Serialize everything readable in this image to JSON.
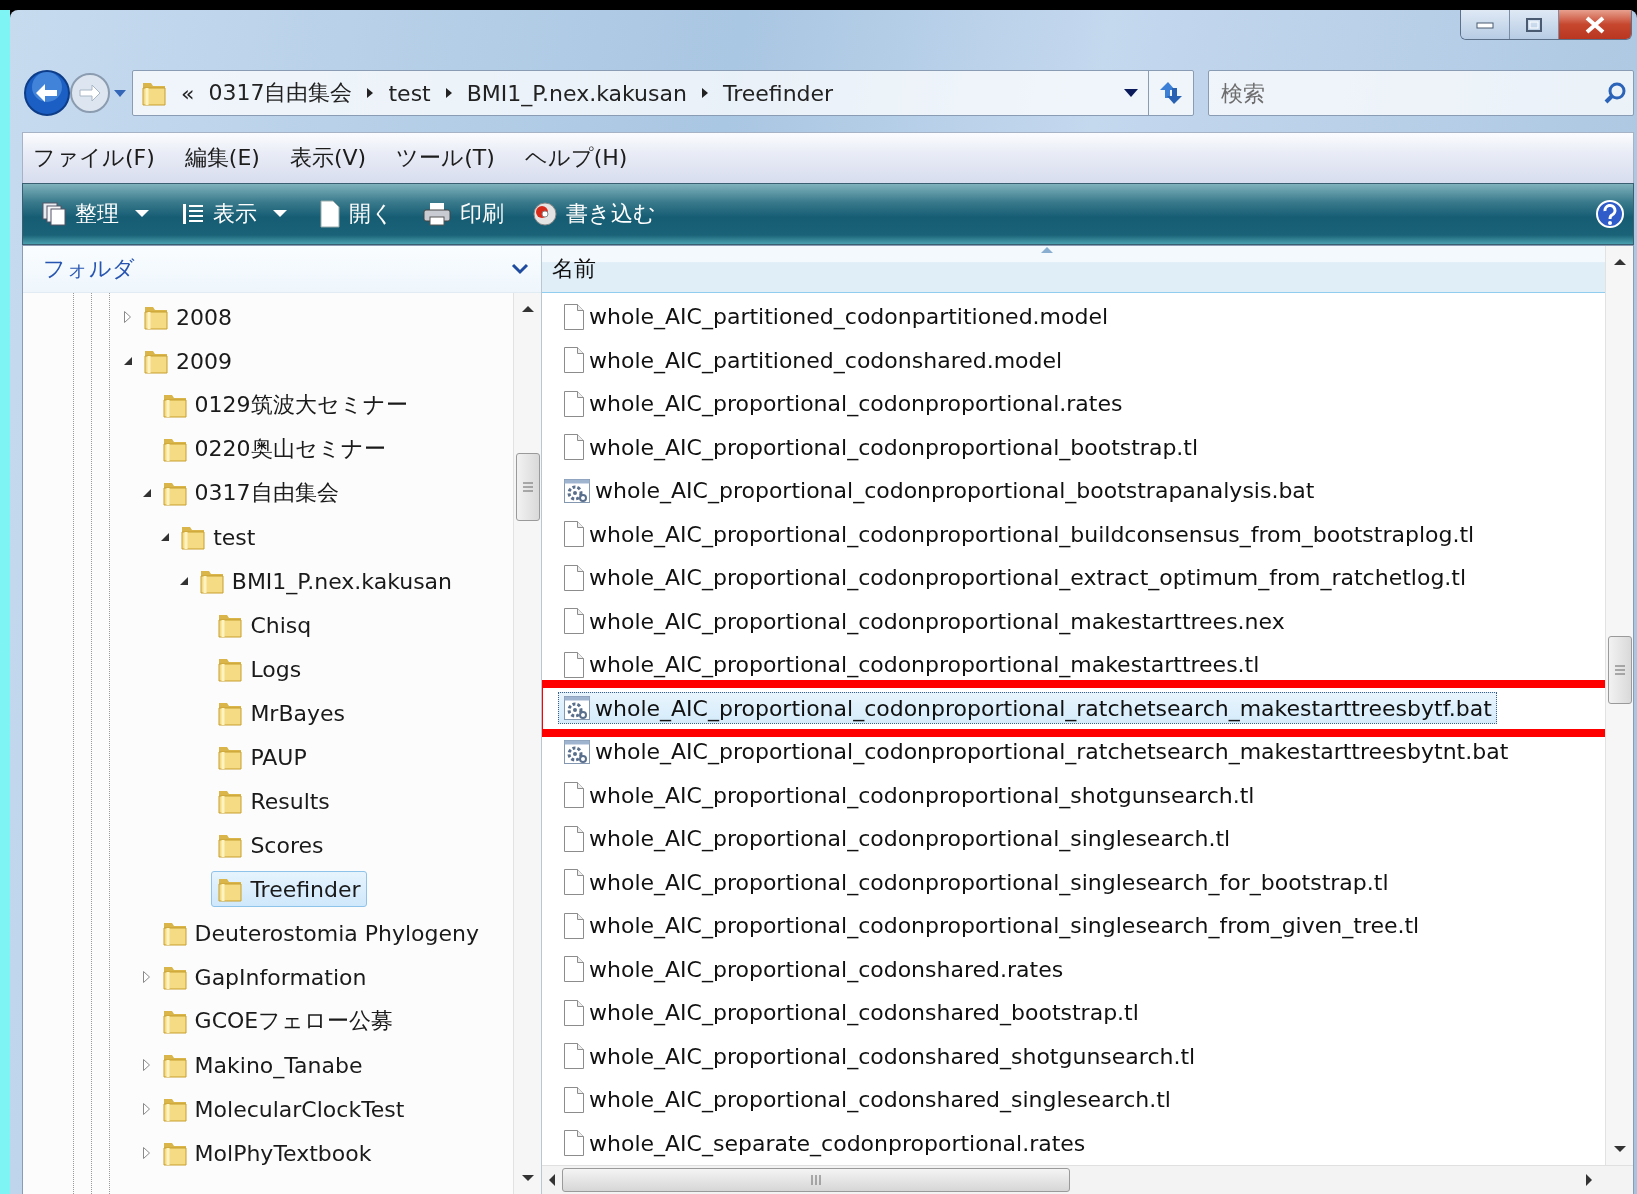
{
  "address_bar": {
    "overflow": "«",
    "crumbs": [
      "0317自由集会",
      "test",
      "BMI1_P.nex.kakusan",
      "Treefinder"
    ]
  },
  "search": {
    "placeholder": "検索"
  },
  "menu_bar": [
    "ファイル(F)",
    "編集(E)",
    "表示(V)",
    "ツール(T)",
    "ヘルプ(H)"
  ],
  "toolbar": [
    {
      "label": "整理",
      "kind": "organize",
      "dropdown": true
    },
    {
      "label": "表示",
      "kind": "views",
      "dropdown": true
    },
    {
      "label": "開く",
      "kind": "open",
      "dropdown": false
    },
    {
      "label": "印刷",
      "kind": "print",
      "dropdown": false
    },
    {
      "label": "書き込む",
      "kind": "burn",
      "dropdown": false
    }
  ],
  "sidebar": {
    "title": "フォルダ",
    "tree": [
      {
        "label": "2008",
        "expanded": false,
        "selected": false
      },
      {
        "label": "2009",
        "expanded": true,
        "selected": false,
        "children": [
          {
            "label": "0129筑波大セミナー",
            "selected": false
          },
          {
            "label": "0220奥山セミナー",
            "selected": false
          },
          {
            "label": "0317自由集会",
            "expanded": true,
            "selected": false,
            "children": [
              {
                "label": "test",
                "expanded": true,
                "selected": false,
                "children": [
                  {
                    "label": "BMI1_P.nex.kakusan",
                    "expanded": true,
                    "selected": false,
                    "children": [
                      {
                        "label": "Chisq",
                        "selected": false
                      },
                      {
                        "label": "Logs",
                        "selected": false
                      },
                      {
                        "label": "MrBayes",
                        "selected": false
                      },
                      {
                        "label": "PAUP",
                        "selected": false
                      },
                      {
                        "label": "Results",
                        "selected": false
                      },
                      {
                        "label": "Scores",
                        "selected": false
                      },
                      {
                        "label": "Treefinder",
                        "selected": true
                      }
                    ]
                  }
                ]
              }
            ]
          },
          {
            "label": "Deuterostomia Phylogeny",
            "selected": false
          },
          {
            "label": "GapInformation",
            "expanded": false,
            "selected": false
          },
          {
            "label": "GCOEフェロー公募",
            "selected": false
          },
          {
            "label": "Makino_Tanabe",
            "expanded": false,
            "selected": false
          },
          {
            "label": "MolecularClockTest",
            "expanded": false,
            "selected": false
          },
          {
            "label": "MolPhyTextbook",
            "expanded": false,
            "selected": false
          }
        ]
      }
    ]
  },
  "file_list": {
    "columns": [
      {
        "label": "名前",
        "sort_ascending": true
      }
    ],
    "rows": [
      {
        "name": "whole_AIC_partitioned_codonpartitioned.model",
        "kind": "document",
        "selected": false,
        "highlighted": false
      },
      {
        "name": "whole_AIC_partitioned_codonshared.model",
        "kind": "document",
        "selected": false,
        "highlighted": false
      },
      {
        "name": "whole_AIC_proportional_codonproportional.rates",
        "kind": "document",
        "selected": false,
        "highlighted": false
      },
      {
        "name": "whole_AIC_proportional_codonproportional_bootstrap.tl",
        "kind": "document",
        "selected": false,
        "highlighted": false
      },
      {
        "name": "whole_AIC_proportional_codonproportional_bootstrapanalysis.bat",
        "kind": "batch",
        "selected": false,
        "highlighted": false
      },
      {
        "name": "whole_AIC_proportional_codonproportional_buildconsensus_from_bootstraplog.tl",
        "kind": "document",
        "selected": false,
        "highlighted": false
      },
      {
        "name": "whole_AIC_proportional_codonproportional_extract_optimum_from_ratchetlog.tl",
        "kind": "document",
        "selected": false,
        "highlighted": false
      },
      {
        "name": "whole_AIC_proportional_codonproportional_makestarttrees.nex",
        "kind": "document",
        "selected": false,
        "highlighted": false
      },
      {
        "name": "whole_AIC_proportional_codonproportional_makestarttrees.tl",
        "kind": "document",
        "selected": false,
        "highlighted": false
      },
      {
        "name": "whole_AIC_proportional_codonproportional_ratchetsearch_makestarttreesbytf.bat",
        "kind": "batch",
        "selected": true,
        "highlighted": true
      },
      {
        "name": "whole_AIC_proportional_codonproportional_ratchetsearch_makestarttreesbytnt.bat",
        "kind": "batch",
        "selected": false,
        "highlighted": false
      },
      {
        "name": "whole_AIC_proportional_codonproportional_shotgunsearch.tl",
        "kind": "document",
        "selected": false,
        "highlighted": false
      },
      {
        "name": "whole_AIC_proportional_codonproportional_singlesearch.tl",
        "kind": "document",
        "selected": false,
        "highlighted": false
      },
      {
        "name": "whole_AIC_proportional_codonproportional_singlesearch_for_bootstrap.tl",
        "kind": "document",
        "selected": false,
        "highlighted": false
      },
      {
        "name": "whole_AIC_proportional_codonproportional_singlesearch_from_given_tree.tl",
        "kind": "document",
        "selected": false,
        "highlighted": false
      },
      {
        "name": "whole_AIC_proportional_codonshared.rates",
        "kind": "document",
        "selected": false,
        "highlighted": false
      },
      {
        "name": "whole_AIC_proportional_codonshared_bootstrap.tl",
        "kind": "document",
        "selected": false,
        "highlighted": false
      },
      {
        "name": "whole_AIC_proportional_codonshared_shotgunsearch.tl",
        "kind": "document",
        "selected": false,
        "highlighted": false
      },
      {
        "name": "whole_AIC_proportional_codonshared_singlesearch.tl",
        "kind": "document",
        "selected": false,
        "highlighted": false
      },
      {
        "name": "whole_AIC_separate_codonproportional.rates",
        "kind": "document",
        "selected": false,
        "highlighted": false
      }
    ]
  }
}
